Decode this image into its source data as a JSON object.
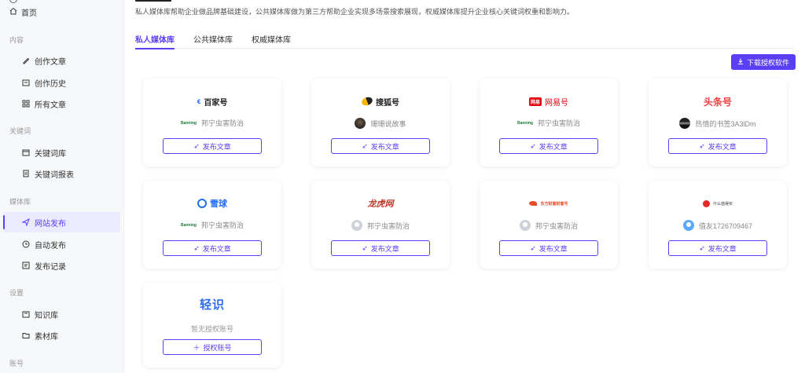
{
  "sidebar": {
    "home": "首页",
    "sections": {
      "content": "内容",
      "keywords": "关键词",
      "media": "媒体库",
      "settings": "设置",
      "account": "账号"
    },
    "items": {
      "create_article": "创作文章",
      "create_history": "创作历史",
      "all_articles": "所有文章",
      "keyword_lib": "关键词库",
      "keyword_report": "关键词报表",
      "site_publish": "网站发布",
      "auto_publish": "自动发布",
      "publish_log": "发布记录",
      "knowledge_base": "知识库",
      "asset_lib": "素材库"
    }
  },
  "header": {
    "description": "私人媒体库帮助企业做品牌基础建设，公共媒体库做为第三方帮助企业实现多场景搜索展现，权威媒体库提升企业核心关键词权重和影响力。"
  },
  "tabs": [
    "私人媒体库",
    "公共媒体库",
    "权威媒体库"
  ],
  "download_button": "下载授权软件",
  "publish_label": "发布文章",
  "authorize_label": "授权账号",
  "cards": [
    {
      "platform": "百家号",
      "account": "邦宁虫害防治",
      "account_badge": "Banning"
    },
    {
      "platform": "搜狐号",
      "account": "珊珊说故事"
    },
    {
      "platform": "网易号",
      "platform_badge": "网易",
      "account": "邦宁虫害防治",
      "account_badge": "Banning"
    },
    {
      "platform": "头条号",
      "account": "热情的书签3A3lDm"
    },
    {
      "platform": "雪球",
      "account": "邦宁虫害防治",
      "account_badge": "Banning"
    },
    {
      "platform": "龙虎网",
      "account": "邦宁虫害防治"
    },
    {
      "platform": "东方财富财富号",
      "account": "邦宁虫害防治"
    },
    {
      "platform": "什么值得买",
      "account": "值友1726709467"
    },
    {
      "platform": "轻识",
      "no_account": "暂无授权账号"
    }
  ],
  "colors": {
    "accent": "#5b3ff5"
  }
}
